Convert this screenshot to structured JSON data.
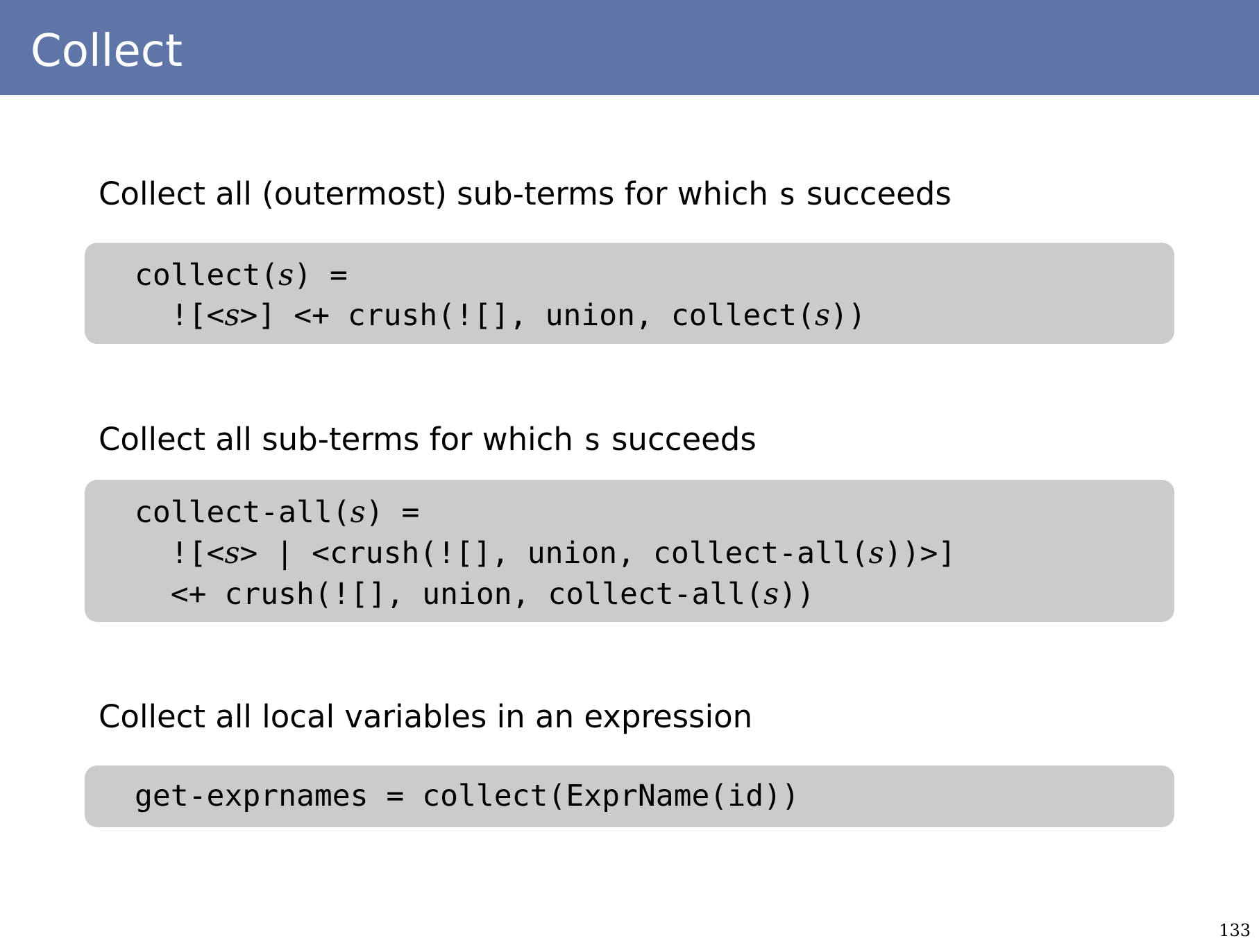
{
  "slide": {
    "title": "Collect",
    "page_number": "133"
  },
  "sections": [
    {
      "heading_before": "Collect all (outermost) sub-terms for which ",
      "heading_var": "s",
      "heading_after": " succeeds",
      "code": [
        {
          "a": "collect(",
          "v": "s",
          "b": ") ="
        },
        {
          "a": "  ![<",
          "v": "s",
          "b": ">] <+ crush(![], union, collect(",
          "v2": "s",
          "c": "))"
        }
      ]
    },
    {
      "heading_before": "Collect all sub-terms for which ",
      "heading_var": "s",
      "heading_after": " succeeds",
      "code": [
        {
          "a": "collect-all(",
          "v": "s",
          "b": ") ="
        },
        {
          "a": "  ![<",
          "v": "s",
          "b": "> | <crush(![], union, collect-all(",
          "v2": "s",
          "c": "))>]"
        },
        {
          "a": "  <+ crush(![], union, collect-all(",
          "v": "s",
          "b": "))"
        }
      ]
    },
    {
      "heading": "Collect all local variables in an expression",
      "code": [
        {
          "a": "get-exprnames = collect(ExprName(id))"
        }
      ]
    }
  ],
  "colors": {
    "title_bar": "#5f74a7",
    "code_background": "#cbcbcb"
  }
}
